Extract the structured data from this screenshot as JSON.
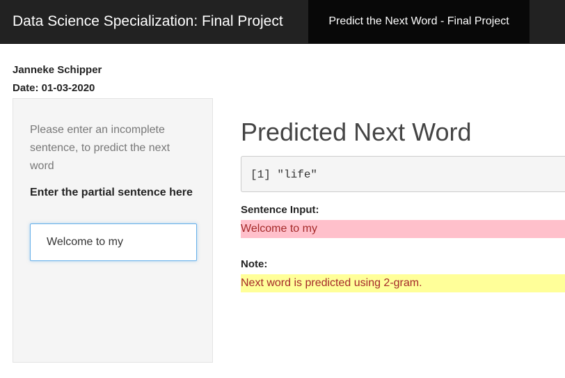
{
  "navbar": {
    "brand": "Data Science Specialization: Final Project",
    "active_tab": "Predict the Next Word - Final Project"
  },
  "header": {
    "author": "Janneke Schipper",
    "date": "Date: 01-03-2020"
  },
  "sidebar": {
    "instructions": "Please enter an incomplete sentence, to predict the next word",
    "input_label": "Enter the partial sentence here",
    "input_value": "Welcome to my"
  },
  "main": {
    "title": "Predicted Next Word",
    "prediction_output": "[1] \"life\"",
    "sentence_label": "Sentence Input:",
    "sentence_value": "Welcome to my",
    "note_label": "Note:",
    "note_value": "Next word is predicted using 2-gram."
  },
  "colors": {
    "navbar_bg": "#222222",
    "active_tab_bg": "#080808",
    "sentence_highlight": "#ffc0cb",
    "note_highlight": "#ffff99",
    "highlight_text": "#a52a2a",
    "input_focus_border": "#66afe9"
  }
}
